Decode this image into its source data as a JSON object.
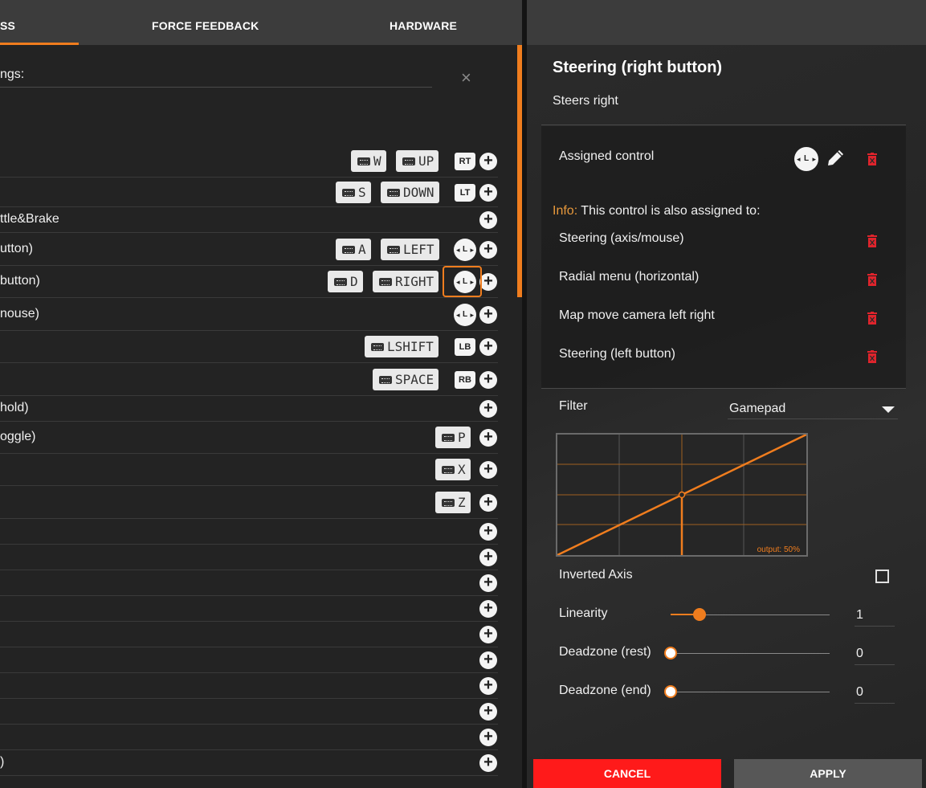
{
  "tabs": [
    {
      "label": "SS",
      "active": true
    },
    {
      "label": "FORCE FEEDBACK",
      "active": false
    },
    {
      "label": "HARDWARE",
      "active": false
    }
  ],
  "search": {
    "label": "ngs:",
    "close_glyph": "×"
  },
  "bindings": [
    {
      "label": "",
      "keys": [
        "W",
        "UP"
      ],
      "gamepad": "RT"
    },
    {
      "label": "",
      "keys": [
        "S",
        "DOWN"
      ],
      "gamepad": "LT"
    },
    {
      "label": "ttle&Brake",
      "keys": [],
      "gamepad": ""
    },
    {
      "label": "utton)",
      "keys": [
        "A",
        "LEFT"
      ],
      "gamepad": "L"
    },
    {
      "label": "button)",
      "keys": [
        "D",
        "RIGHT"
      ],
      "gamepad": "L",
      "selected": true
    },
    {
      "label": "nouse)",
      "keys": [],
      "gamepad": "L"
    },
    {
      "label": "",
      "keys": [
        "LSHIFT"
      ],
      "gamepad": "LB"
    },
    {
      "label": "",
      "keys": [
        "SPACE"
      ],
      "gamepad": "RB"
    },
    {
      "label": "hold)",
      "keys": [],
      "gamepad": ""
    },
    {
      "label": "oggle)",
      "keys": [
        "P"
      ],
      "gamepad": ""
    },
    {
      "label": "",
      "keys": [
        "X"
      ],
      "gamepad": ""
    },
    {
      "label": "",
      "keys": [
        "Z"
      ],
      "gamepad": ""
    },
    {
      "label": "",
      "keys": [],
      "gamepad": ""
    },
    {
      "label": "",
      "keys": [],
      "gamepad": ""
    },
    {
      "label": "",
      "keys": [],
      "gamepad": ""
    },
    {
      "label": "",
      "keys": [],
      "gamepad": ""
    },
    {
      "label": "",
      "keys": [],
      "gamepad": ""
    },
    {
      "label": "",
      "keys": [],
      "gamepad": ""
    },
    {
      "label": "",
      "keys": [],
      "gamepad": ""
    },
    {
      "label": "",
      "keys": [],
      "gamepad": ""
    },
    {
      "label": "",
      "keys": [],
      "gamepad": ""
    },
    {
      "label": ")",
      "keys": [],
      "gamepad": ""
    }
  ],
  "detail": {
    "title": "Steering (right button)",
    "description": "Steers right",
    "assigned_label": "Assigned control",
    "assigned_gamepad": "L",
    "info_prefix": "Info:",
    "info_text": " This control is also assigned to:",
    "also_assigned": [
      "Steering (axis/mouse)",
      "Radial menu (horizontal)",
      "Map move camera left right",
      "Steering (left button)"
    ],
    "filter_label": "Filter",
    "filter_value": "Gamepad",
    "output_label": "output: 50%",
    "output_fraction": 0.5,
    "inverted_label": "Inverted Axis",
    "inverted_checked": false,
    "sliders": [
      {
        "label": "Linearity",
        "value": "1",
        "fraction": 0.18
      },
      {
        "label": "Deadzone (rest)",
        "value": "0",
        "fraction": 0.0
      },
      {
        "label": "Deadzone (end)",
        "value": "0",
        "fraction": 0.0
      }
    ],
    "cancel_label": "CANCEL",
    "apply_label": "APPLY"
  },
  "colors": {
    "accent": "#f07d1e",
    "cancel": "#ff1a1a",
    "trash": "#e0242c"
  },
  "icons": {
    "keyboard": "keyboard-icon",
    "plus": "plus-icon",
    "edit": "pencil-icon",
    "trash": "trash-icon",
    "caret": "chevron-down-icon"
  }
}
